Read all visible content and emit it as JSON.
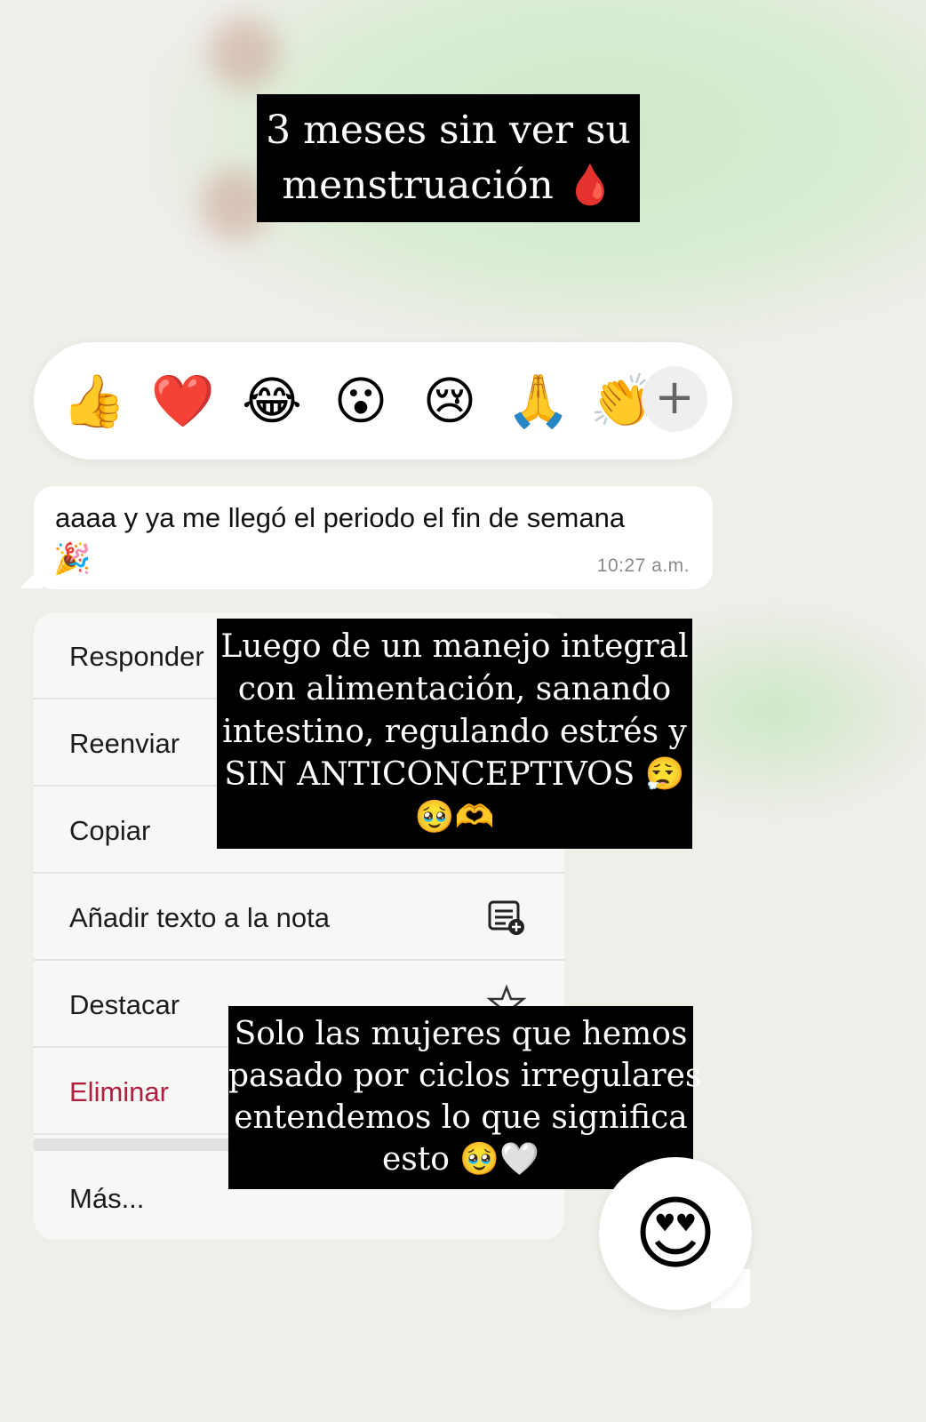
{
  "caption_top": {
    "line1": "3 meses sin ver su",
    "line2": "menstruación",
    "emoji": "🩸"
  },
  "reactions": {
    "emojis": [
      "👍",
      "❤️",
      "😂",
      "😮",
      "😢",
      "🙏",
      "👏"
    ],
    "more_label": "+"
  },
  "message": {
    "text": "aaaa y ya me llegó el periodo el fin de semana",
    "emoji": "🎉",
    "time": "10:27 a.m."
  },
  "menu": {
    "items": [
      {
        "label": "Responder",
        "icon": "reply-icon"
      },
      {
        "label": "Reenviar",
        "icon": "forward-icon"
      },
      {
        "label": "Copiar",
        "icon": "copy-icon"
      },
      {
        "label": "Añadir texto a la nota",
        "icon": "add-note-icon"
      },
      {
        "label": "Destacar",
        "icon": "star-icon"
      },
      {
        "label": "Eliminar",
        "icon": "trash-icon"
      }
    ],
    "more_label": "Más..."
  },
  "caption_mid": {
    "line1": "Luego de un manejo integral",
    "line2": "con alimentación, sanando",
    "line3": "intestino, regulando estrés y",
    "line4": "SIN ANTICONCEPTIVOS 😮‍💨",
    "line5": "🥹🫶"
  },
  "caption_bottom": {
    "line1": "Solo las mujeres que hemos",
    "line2": "pasado por ciclos irregulares",
    "line3": "entendemos lo que significa",
    "line4": "esto 🥹🤍"
  },
  "selected_reaction": "😍",
  "colors": {
    "danger": "#b21f3e",
    "caption_bg": "#000000",
    "bubble_bg": "#ffffff"
  }
}
